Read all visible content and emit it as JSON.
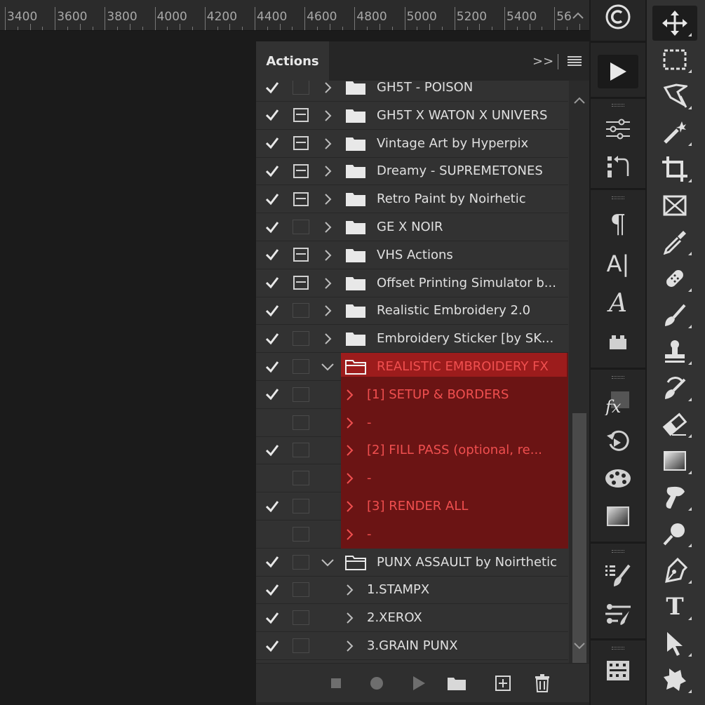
{
  "ruler": {
    "labels": [
      "3400",
      "3600",
      "3800",
      "4000",
      "4200",
      "4400",
      "4600",
      "4800",
      "5000",
      "5200",
      "5400",
      "56"
    ]
  },
  "panel": {
    "tab_label": "Actions",
    "collapse_label": ">>"
  },
  "rows": [
    {
      "label": "GH5T - POISON",
      "type": "set",
      "checked": true,
      "dialog": false,
      "expanded": false
    },
    {
      "label": "GH5T X WATON X UNIVERS",
      "type": "set",
      "checked": true,
      "dialog": true,
      "expanded": false
    },
    {
      "label": "Vintage Art by Hyperpix",
      "type": "set",
      "checked": true,
      "dialog": true,
      "expanded": false
    },
    {
      "label": "Dreamy - SUPREMETONES",
      "type": "set",
      "checked": true,
      "dialog": true,
      "expanded": false
    },
    {
      "label": "Retro Paint by Noirhetic",
      "type": "set",
      "checked": true,
      "dialog": true,
      "expanded": false
    },
    {
      "label": "GE X NOIR",
      "type": "set",
      "checked": true,
      "dialog": false,
      "expanded": false
    },
    {
      "label": "VHS Actions",
      "type": "set",
      "checked": true,
      "dialog": true,
      "expanded": false
    },
    {
      "label": "Offset Printing Simulator b...",
      "type": "set",
      "checked": true,
      "dialog": true,
      "expanded": false
    },
    {
      "label": "Realistic Embroidery 2.0",
      "type": "set",
      "checked": true,
      "dialog": false,
      "expanded": false
    },
    {
      "label": "Embroidery Sticker [by SK...",
      "type": "set",
      "checked": true,
      "dialog": false,
      "expanded": false
    },
    {
      "label": "REALISTIC  EMBROIDERY FX",
      "type": "set",
      "checked": true,
      "dialog": false,
      "expanded": true,
      "selected": true
    },
    {
      "label": "[1] SETUP & BORDERS",
      "type": "action",
      "checked": true,
      "dialog": false,
      "selected": true
    },
    {
      "label": "-",
      "type": "action",
      "checked": false,
      "dialog": false,
      "selected": true
    },
    {
      "label": "[2] FILL PASS (optional, re...",
      "type": "action",
      "checked": true,
      "dialog": false,
      "selected": true
    },
    {
      "label": "-",
      "type": "action",
      "checked": false,
      "dialog": false,
      "selected": true
    },
    {
      "label": "[3] RENDER ALL",
      "type": "action",
      "checked": true,
      "dialog": false,
      "selected": true
    },
    {
      "label": "-",
      "type": "action",
      "checked": false,
      "dialog": false,
      "selected": true
    },
    {
      "label": "PUNX ASSAULT by Noirthetic",
      "type": "set",
      "checked": true,
      "dialog": false,
      "expanded": true
    },
    {
      "label": "1.STAMPX",
      "type": "action",
      "checked": true,
      "dialog": false
    },
    {
      "label": "2.XEROX",
      "type": "action",
      "checked": true,
      "dialog": false
    },
    {
      "label": "3.GRAIN PUNX",
      "type": "action",
      "checked": true,
      "dialog": false
    }
  ],
  "bottom_buttons": [
    "stop-icon",
    "record-icon",
    "play-icon",
    "new-set-icon",
    "new-action-icon",
    "delete-icon"
  ],
  "colors": {
    "selection_dark": "#6b1414",
    "selection_bright": "#9c1c1c",
    "selection_text": "#f04f4f",
    "panel_bg": "#323232"
  },
  "dock_icons": [
    "copyright-icon",
    "play-action-icon",
    "adjustments-icon",
    "transform-history-icon",
    "paragraph-icon",
    "character-icon",
    "glyphs-icon",
    "lego-icon",
    "styles-fx-icon",
    "history-icon",
    "swatches-icon",
    "gradients-icon",
    "brush-settings-icon",
    "tool-presets-icon",
    "timeline-icon"
  ],
  "tools": [
    "move-tool-icon",
    "marquee-tool-icon",
    "lasso-tool-icon",
    "magic-wand-icon",
    "crop-tool-icon",
    "frame-tool-icon",
    "eyedropper-icon",
    "healing-brush-icon",
    "brush-tool-icon",
    "clone-stamp-icon",
    "history-brush-icon",
    "eraser-icon",
    "gradient-tool-icon",
    "smudge-tool-icon",
    "dodge-tool-icon",
    "pen-tool-icon",
    "type-tool-icon",
    "path-selection-icon",
    "custom-shape-icon"
  ]
}
